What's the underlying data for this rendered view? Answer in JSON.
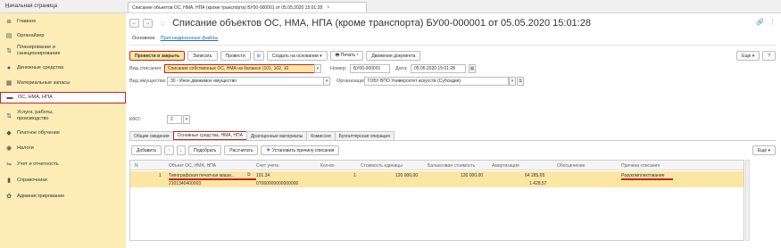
{
  "home_tab": {
    "label": "Начальная страница"
  },
  "doc_tab": {
    "label": "Списание объектов ОС, НМА, НПА (кроме транспорта) БУ00-000001 от 05.05.2020 15:01:28",
    "close": "×"
  },
  "sidebar": {
    "items": [
      {
        "label": "Главное",
        "icon": "menu-icon",
        "glyph": "≣"
      },
      {
        "label": "Органайзер",
        "icon": "calendar-icon",
        "glyph": "▤"
      },
      {
        "label": "Планирование и санкционирование",
        "icon": "planning-icon",
        "glyph": "⇅"
      },
      {
        "label": "Денежные средства",
        "icon": "money-icon",
        "glyph": "●"
      },
      {
        "label": "Материальные запасы",
        "icon": "stock-icon",
        "glyph": "▦"
      },
      {
        "label": "ОС, НМА, НПА",
        "icon": "assets-icon",
        "glyph": "▬"
      },
      {
        "label": "Услуги, работы, производство",
        "icon": "services-icon",
        "glyph": "⇅"
      },
      {
        "label": "Платное обучение",
        "icon": "education-icon",
        "glyph": "◆"
      },
      {
        "label": "Налоги",
        "icon": "taxes-icon",
        "glyph": "◉"
      },
      {
        "label": "Учет и отчетность",
        "icon": "reports-icon",
        "glyph": "⇋"
      },
      {
        "label": "Справочники",
        "icon": "books-icon",
        "glyph": "▮"
      },
      {
        "label": "Администрирование",
        "icon": "gear-icon",
        "glyph": "✿"
      }
    ]
  },
  "header": {
    "back": "←",
    "forward": "→",
    "star": "☆",
    "title": "Списание объектов ОС, НМА, НПА (кроме транспорта) БУ00-000001 от 05.05.2020 15:01:28",
    "link_icon": "🔗",
    "more": "⋮"
  },
  "links": {
    "main": "Основное",
    "files": "Присоединенные файлы"
  },
  "toolbar": {
    "post_close": "Провести и закрыть",
    "save": "Записать",
    "post": "Провести",
    "create_based": "Создать на основании ▾",
    "print": "🖶 Печать ▾",
    "movements": "Движения документа",
    "more": "Еще ▾",
    "help": "?"
  },
  "form": {
    "writeoff_type_label": "Вид списания:",
    "writeoff_type_value": "Списание собственных ОС, НМА на балансе (101, 102, 10",
    "number_label": "Номер:",
    "number_value": "БУ00-000001",
    "date_label": "Дата:",
    "date_value": "05.05.2020 15:01:28",
    "property_label": "Вид имущества:",
    "property_value": "30 - Иное движимое имущество",
    "org_label": "Организация:",
    "org_value": "ГОБУ ВПО Университет искусств (Субсидия)",
    "kfo_label": "КФО:",
    "kfo_value": "2"
  },
  "tabs": [
    {
      "label": "Общие сведения"
    },
    {
      "label": "Основные средства, НМА, НПА"
    },
    {
      "label": "Драгоценные материалы"
    },
    {
      "label": "Комиссия"
    },
    {
      "label": "Бухгалтерская операция"
    }
  ],
  "table_toolbar": {
    "add": "Добавить",
    "up": "↑",
    "down": "↓",
    "select": "Подобрать",
    "calc": "Рассчитать",
    "set_reason": "Установить причину списания",
    "more": "Еще ▾"
  },
  "table": {
    "columns": [
      "N",
      "Объект ОС, НМА, НПА",
      "Счет учета",
      "Кол-во",
      "Стоимость единицы",
      "Балансовая стоимость",
      "Амортизация",
      "Обесценение",
      "Причина списания"
    ],
    "rows": [
      {
        "n": "1",
        "object": "Типографская печатная маши...",
        "object_code": "2101340400003",
        "account": "101.34",
        "account_sub": "07060000000000000",
        "qty": "1",
        "unit_cost": "120 000,00",
        "book_value": "120 000,00",
        "amortization": "64 285,65",
        "amortization_sub": "1 428,57",
        "impairment": "",
        "reason": "Разукомплектование"
      }
    ]
  }
}
